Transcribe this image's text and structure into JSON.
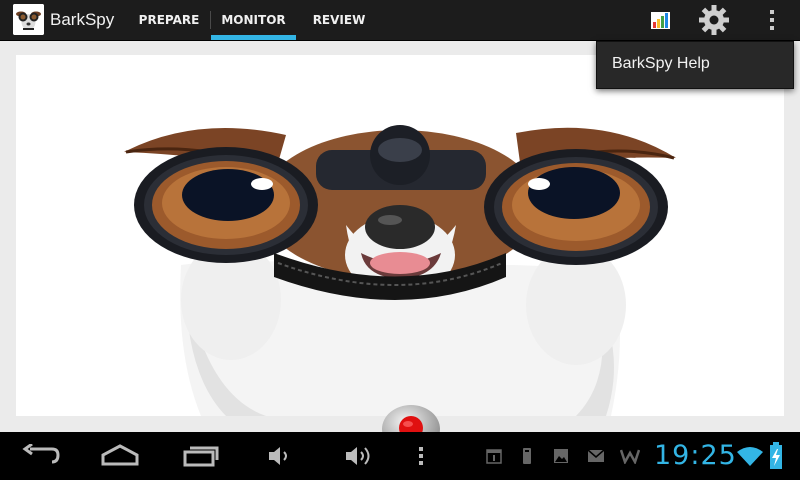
{
  "app": {
    "title": "BarkSpy",
    "logo_icon": "dog-binoculars-icon"
  },
  "tabs": [
    {
      "label": "PREPARE",
      "selected": false
    },
    {
      "label": "MONITOR",
      "selected": true
    },
    {
      "label": "REVIEW",
      "selected": false
    }
  ],
  "actions": [
    {
      "icon": "bar-chart-icon"
    },
    {
      "icon": "gear-icon"
    },
    {
      "icon": "overflow-menu-icon"
    }
  ],
  "overflow_menu": {
    "items": [
      {
        "label": "BarkSpy Help"
      }
    ]
  },
  "content": {
    "image": "dog-with-binoculars",
    "record_button": "record-button"
  },
  "system_bar": {
    "time": "19:25",
    "notification_icons": [
      "calendar-icon",
      "usb-icon",
      "gallery-icon",
      "email-icon",
      "w-app-icon"
    ],
    "status_icons": [
      "wifi-icon",
      "battery-charging-icon"
    ]
  },
  "colors": {
    "accent": "#33b5e5",
    "action_bar": "#1c1c1c",
    "menu_bg": "#282828",
    "record_red": "#e01010"
  }
}
